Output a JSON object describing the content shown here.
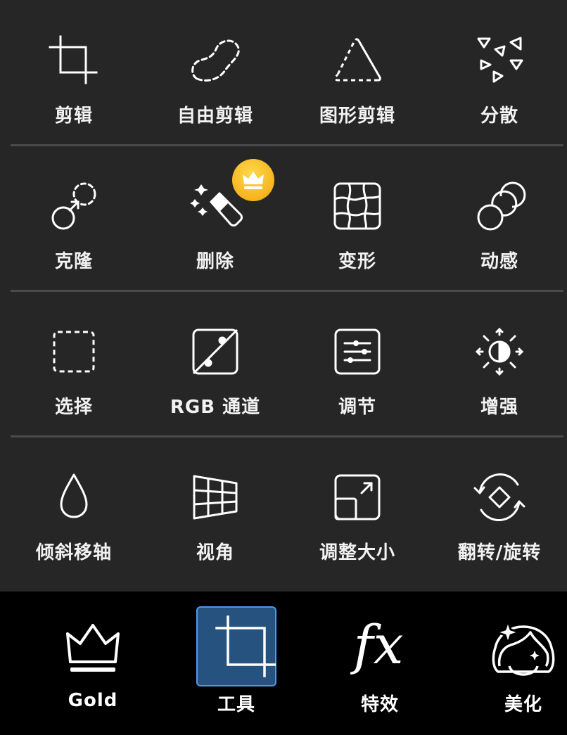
{
  "tools": {
    "rows": [
      [
        {
          "label": "剪辑",
          "icon": "crop-icon"
        },
        {
          "label": "自由剪辑",
          "icon": "freeform-crop-icon"
        },
        {
          "label": "图形剪辑",
          "icon": "shape-crop-icon"
        },
        {
          "label": "分散",
          "icon": "disperse-icon"
        }
      ],
      [
        {
          "label": "克隆",
          "icon": "clone-icon"
        },
        {
          "label": "删除",
          "icon": "eraser-icon",
          "premium": true
        },
        {
          "label": "变形",
          "icon": "warp-grid-icon"
        },
        {
          "label": "动感",
          "icon": "motion-circles-icon"
        }
      ],
      [
        {
          "label": "选择",
          "icon": "selection-icon"
        },
        {
          "label": "RGB 通道",
          "icon": "curves-icon"
        },
        {
          "label": "调节",
          "icon": "adjust-sliders-icon"
        },
        {
          "label": "增强",
          "icon": "enhance-icon"
        }
      ],
      [
        {
          "label": "倾斜移轴",
          "icon": "drop-icon"
        },
        {
          "label": "视角",
          "icon": "perspective-icon"
        },
        {
          "label": "调整大小",
          "icon": "resize-icon"
        },
        {
          "label": "翻转/旋转",
          "icon": "flip-rotate-icon"
        }
      ]
    ]
  },
  "bottom_nav": {
    "items": [
      {
        "label": "Gold",
        "icon": "crown-icon"
      },
      {
        "label": "工具",
        "icon": "crop-icon",
        "selected": true
      },
      {
        "label": "特效",
        "icon": "fx-icon"
      },
      {
        "label": "美化",
        "icon": "face-sparkle-icon"
      }
    ]
  },
  "colors": {
    "background": "#262626",
    "bottom_bar": "#000000",
    "divider": "#4a4a4a",
    "selected_fill": "#25527f",
    "selected_border": "#4c9be8",
    "premium_badge": "#f5b41e"
  }
}
